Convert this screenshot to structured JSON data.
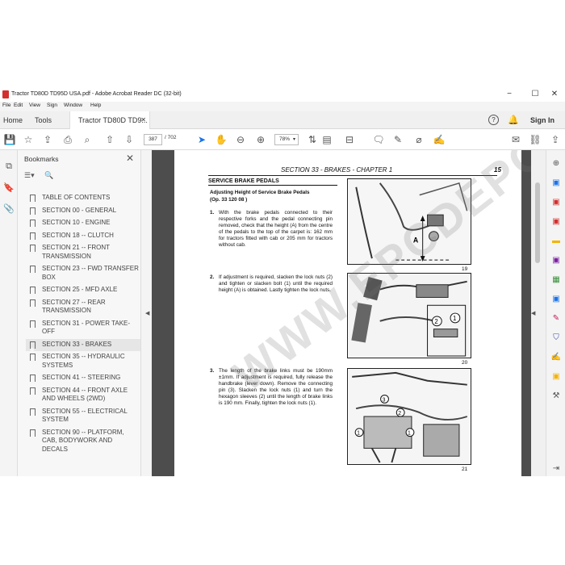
{
  "window": {
    "title": "Tractor TD80D TD95D USA.pdf - Adobe Acrobat Reader DC (32-bit)"
  },
  "menu": [
    "File",
    "Edit",
    "View",
    "Sign",
    "Window",
    "Help"
  ],
  "tabs": {
    "home": "Home",
    "tools": "Tools",
    "document": "Tractor TD80D TD9..."
  },
  "header_right": {
    "help": "?",
    "signin": "Sign In"
  },
  "toolbar": {
    "page_current": "387",
    "page_total": "/ 702",
    "zoom": "78%"
  },
  "bookmarks": {
    "title": "Bookmarks",
    "items": [
      "TABLE OF CONTENTS",
      "SECTION 00 - GENERAL",
      "SECTION 10 - ENGINE",
      "SECTION 18 -- CLUTCH",
      "SECTION 21 -- FRONT TRANSMISSION",
      "SECTION 23 -- FWD TRANSFER BOX",
      "SECTION 25 - MFD AXLE",
      "SECTION 27 -- REAR TRANSMISSION",
      "SECTION 31 - POWER TAKE-OFF",
      "SECTION 33 - BRAKES",
      "SECTION 35 -- HYDRAULIC SYSTEMS",
      "SECTION 41 -- STEERING",
      "SECTION 44 -- FRONT AXLE AND WHEELS (2WD)",
      "SECTION 55 -- ELECTRICAL SYSTEM",
      "SECTION 90 -- PLATFORM, CAB, BODYWORK AND DECALS"
    ],
    "selected_index": 9
  },
  "page": {
    "header_section": "SECTION 33 - BRAKES - CHAPTER 1",
    "page_number": "15",
    "title": "SERVICE BRAKE PEDALS",
    "subtitle": "Adjusting Height of Service Brake Pedals",
    "op": "(Op. 33 120 08 )",
    "steps": [
      {
        "num": "1.",
        "text": "With the brake pedals connected to their respective forks and the pedal connecting pin removed, check that the height (A) from the centre of the pedals to the top of the carpet is: 162 mm for tractors fitted with cab or 205 mm for tractors without cab."
      },
      {
        "num": "2.",
        "text": "If adjustment is required, slacken the lock nuts (2) and tighten or slacken bolt (1) until the required height (A) is obtained. Lastly tighten the lock nuts."
      },
      {
        "num": "3.",
        "text": "The length of the brake links must be 190mm ±1mm. If adjustment is required, fully release the handbrake (lever down). Remove the connecting pin (3). Slacken the lock nuts (1) and turn the hexagon sleeves (2) until the length of brake links is 190 mm. Finally, tighten the lock nuts (1)."
      }
    ],
    "figures": [
      {
        "num": "19",
        "label_a": "A"
      },
      {
        "num": "20",
        "callouts": [
          "2",
          "1"
        ]
      },
      {
        "num": "21",
        "callouts": [
          "3",
          "2",
          "1",
          "1"
        ]
      }
    ],
    "watermark": "WWW.EPCDEPOT.COM"
  },
  "colors": {
    "doc_background": "#4d4d4d",
    "accent_blue": "#1a73e8"
  }
}
